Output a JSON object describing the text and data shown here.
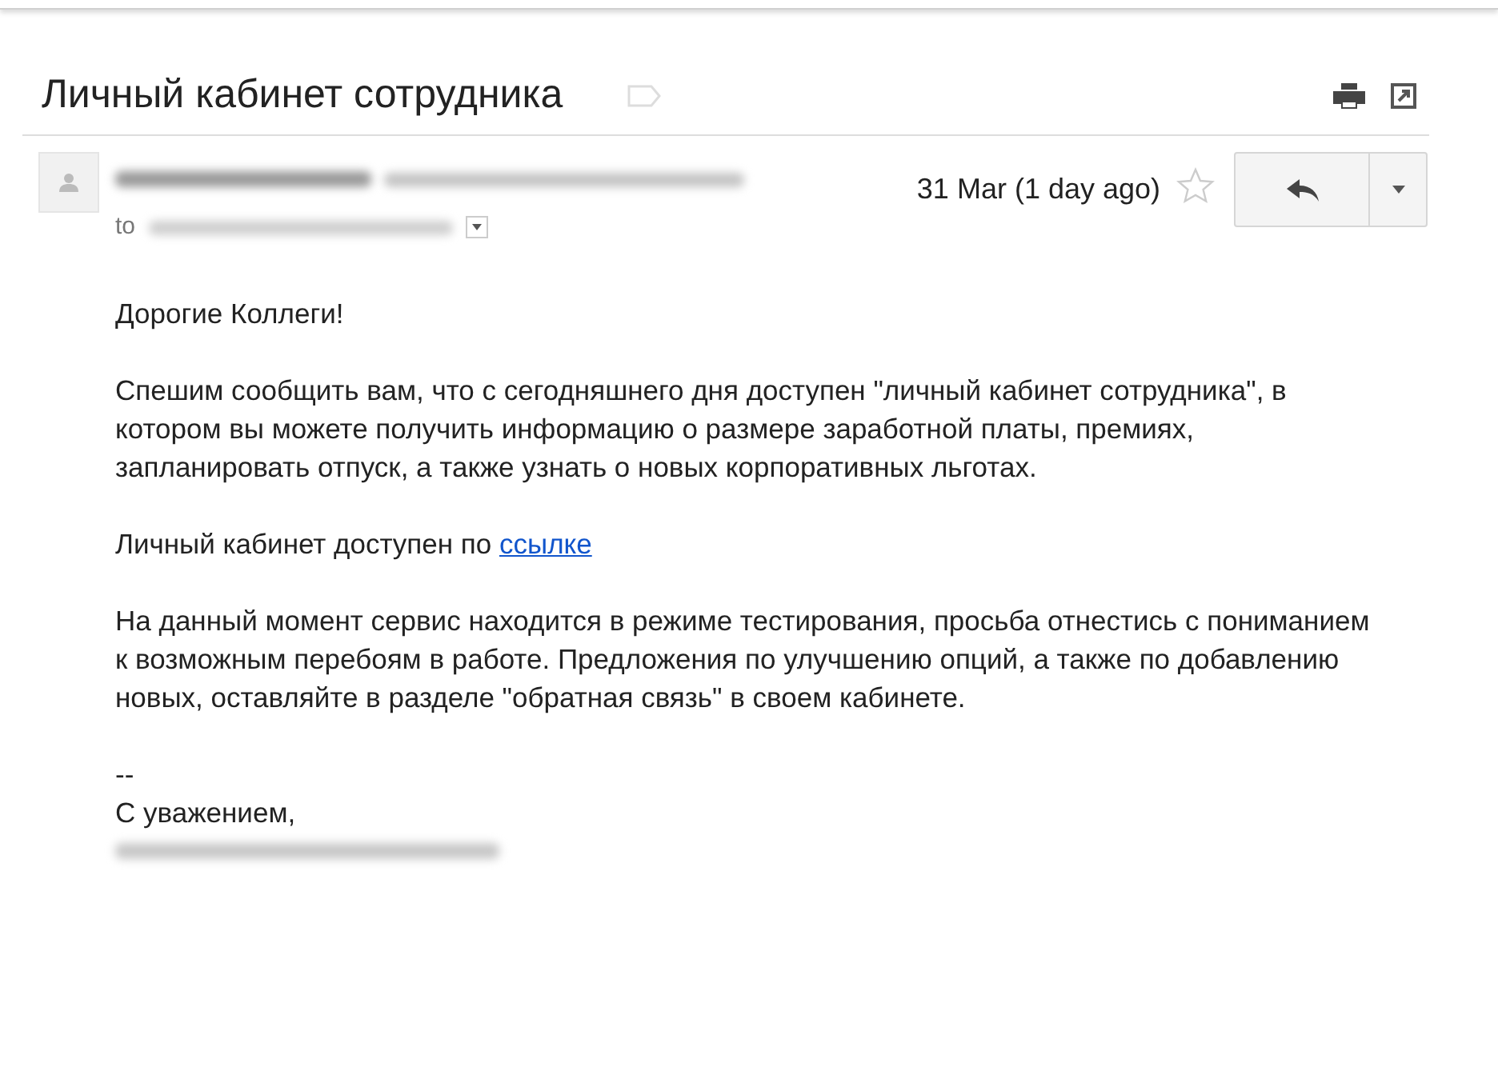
{
  "subject": "Личный кабинет сотрудника",
  "message": {
    "date": "31 Mar (1 day ago)",
    "starred": false,
    "to_label": "to"
  },
  "body": {
    "greeting": "Дорогие Коллеги!",
    "paragraphs": [
      {
        "text": "Спешим сообщить вам, что с сегодняшнего дня доступен \"личный кабинет сотрудника\", в котором вы можете получить информацию о размере заработной платы, премиях, запланировать отпуск, а также узнать о новых корпоративных льготах."
      },
      {
        "text": "Личный кабинет доступен по ",
        "link": "ссылке"
      },
      {
        "text": "На данный момент сервис находится в режиме тестирования, просьба отнестись с пониманием к возможным перебоям в работе. Предложения по улучшению опций, а также по добавлению новых, оставляйте в разделе \"обратная связь\" в своем кабинете."
      }
    ],
    "signature_dash": "--",
    "closing": "С уважением,"
  }
}
